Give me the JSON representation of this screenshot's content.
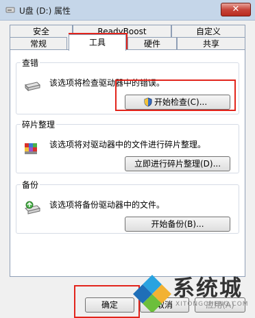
{
  "window": {
    "title": "U盘 (D:) 属性",
    "close_label": "✕"
  },
  "tabs": {
    "row_back": [
      "安全",
      "ReadyBoost",
      "自定义"
    ],
    "row_front": [
      "常规",
      "工具",
      "硬件",
      "共享"
    ],
    "active": "工具"
  },
  "groups": {
    "error_check": {
      "title": "查错",
      "description": "该选项将检查驱动器中的错误。",
      "button_label": "开始检查(C)..."
    },
    "defrag": {
      "title": "碎片整理",
      "description": "该选项将对驱动器中的文件进行碎片整理。",
      "button_label": "立即进行碎片整理(D)..."
    },
    "backup": {
      "title": "备份",
      "description": "该选项将备份驱动器中的文件。",
      "button_label": "开始备份(B)..."
    }
  },
  "footer": {
    "ok_label": "确定",
    "cancel_label": "取消",
    "apply_label": "应用(A)"
  },
  "watermark": {
    "text": "系统城",
    "sub": "XITONGCHENG.COM"
  },
  "colors": {
    "highlight": "#e2231a",
    "titlebar": "#c5d6e9"
  }
}
